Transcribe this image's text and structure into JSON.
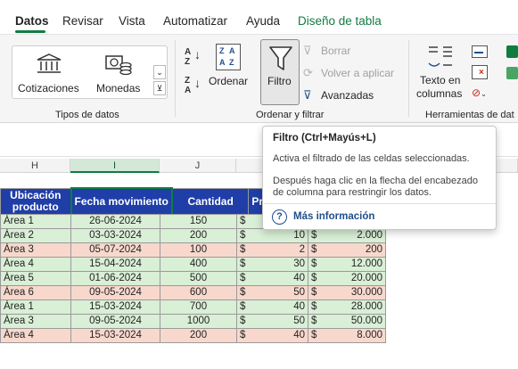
{
  "tabs": {
    "datos": "Datos",
    "revisar": "Revisar",
    "vista": "Vista",
    "automatizar": "Automatizar",
    "ayuda": "Ayuda",
    "diseno": "Diseño de tabla"
  },
  "ribbon": {
    "tipos_group": "Tipos de datos",
    "cotizaciones": "Cotizaciones",
    "monedas": "Monedas",
    "ordenar": "Ordenar",
    "filtro": "Filtro",
    "borrar": "Borrar",
    "volver": "Volver a aplicar",
    "avanzadas": "Avanzadas",
    "orden_group": "Ordenar y filtrar",
    "texto_line1": "Texto en",
    "texto_line2": "columnas",
    "herr_group": "Herramientas de dat"
  },
  "columns": [
    "H",
    "I",
    "J"
  ],
  "table": {
    "headers": {
      "h_line1": "Ubicación",
      "h_line2": "producto",
      "i": "Fecha movimiento",
      "j": "Cantidad",
      "k": "Prec"
    },
    "rows": [
      {
        "area": "Área 1",
        "fecha": "26-06-2024",
        "cantidad": "150",
        "cur": "$",
        "precio": "10",
        "cur2": "$",
        "total": "1.500"
      },
      {
        "area": "Área 2",
        "fecha": "03-03-2024",
        "cantidad": "200",
        "cur": "$",
        "precio": "10",
        "cur2": "$",
        "total": "2.000"
      },
      {
        "area": "Área 3",
        "fecha": "05-07-2024",
        "cantidad": "100",
        "cur": "$",
        "precio": "2",
        "cur2": "$",
        "total": "200"
      },
      {
        "area": "Área 4",
        "fecha": "15-04-2024",
        "cantidad": "400",
        "cur": "$",
        "precio": "30",
        "cur2": "$",
        "total": "12.000"
      },
      {
        "area": "Área 5",
        "fecha": "01-06-2024",
        "cantidad": "500",
        "cur": "$",
        "precio": "40",
        "cur2": "$",
        "total": "20.000"
      },
      {
        "area": "Área 6",
        "fecha": "09-05-2024",
        "cantidad": "600",
        "cur": "$",
        "precio": "50",
        "cur2": "$",
        "total": "30.000"
      },
      {
        "area": "Área 1",
        "fecha": "15-03-2024",
        "cantidad": "700",
        "cur": "$",
        "precio": "40",
        "cur2": "$",
        "total": "28.000"
      },
      {
        "area": "Área 3",
        "fecha": "09-05-2024",
        "cantidad": "1000",
        "cur": "$",
        "precio": "50",
        "cur2": "$",
        "total": "50.000"
      },
      {
        "area": "Área 4",
        "fecha": "15-03-2024",
        "cantidad": "200",
        "cur": "$",
        "precio": "40",
        "cur2": "$",
        "total": "8.000"
      }
    ]
  },
  "tooltip": {
    "title": "Filtro (Ctrl+Mayús+L)",
    "p1": "Activa el filtrado de las celdas seleccionadas.",
    "p2": "Después haga clic en la flecha del encabezado de columna para restringir los datos.",
    "link": "Más información",
    "q": "?"
  },
  "colors": {
    "accent_green": "#107c41",
    "header_blue": "#1f3ea7",
    "row_green": "#d9efd6",
    "row_pink": "#f8d8cd"
  }
}
